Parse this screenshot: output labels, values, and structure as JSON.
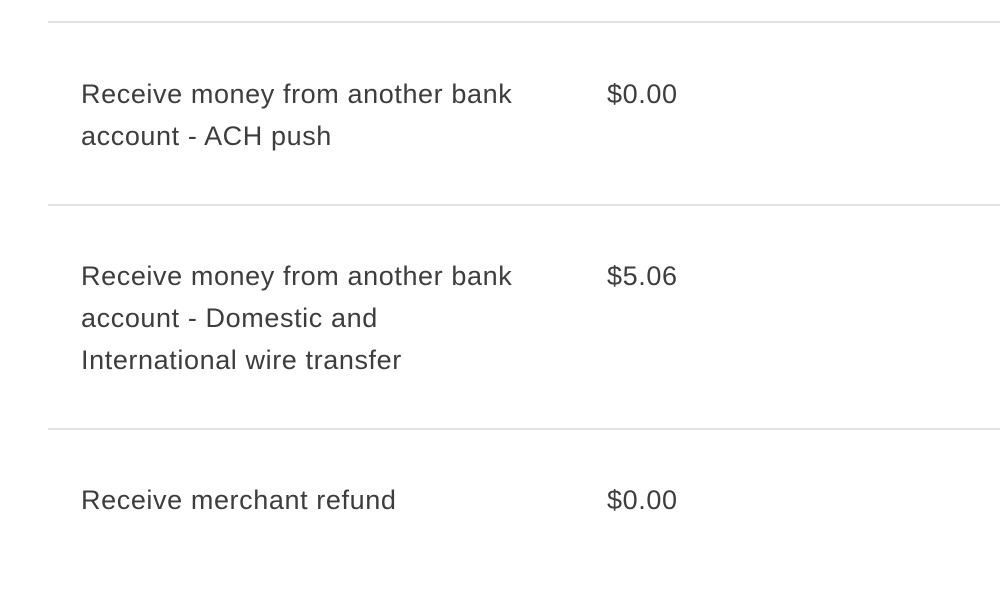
{
  "fee_rows": [
    {
      "description_line1": "Receive money from another bank",
      "description_line2": "account - ACH push",
      "description_line3": "",
      "amount": "$0.00"
    },
    {
      "description_line1": "Receive money from another bank",
      "description_line2": "account - Domestic and",
      "description_line3": "International wire transfer",
      "amount": "$5.06"
    },
    {
      "description_line1": "Receive merchant refund",
      "description_line2": "",
      "description_line3": "",
      "amount": "$0.00"
    }
  ],
  "colors": {
    "text": "#3d3d3d",
    "divider": "#e3e3e3",
    "background": "#ffffff"
  }
}
